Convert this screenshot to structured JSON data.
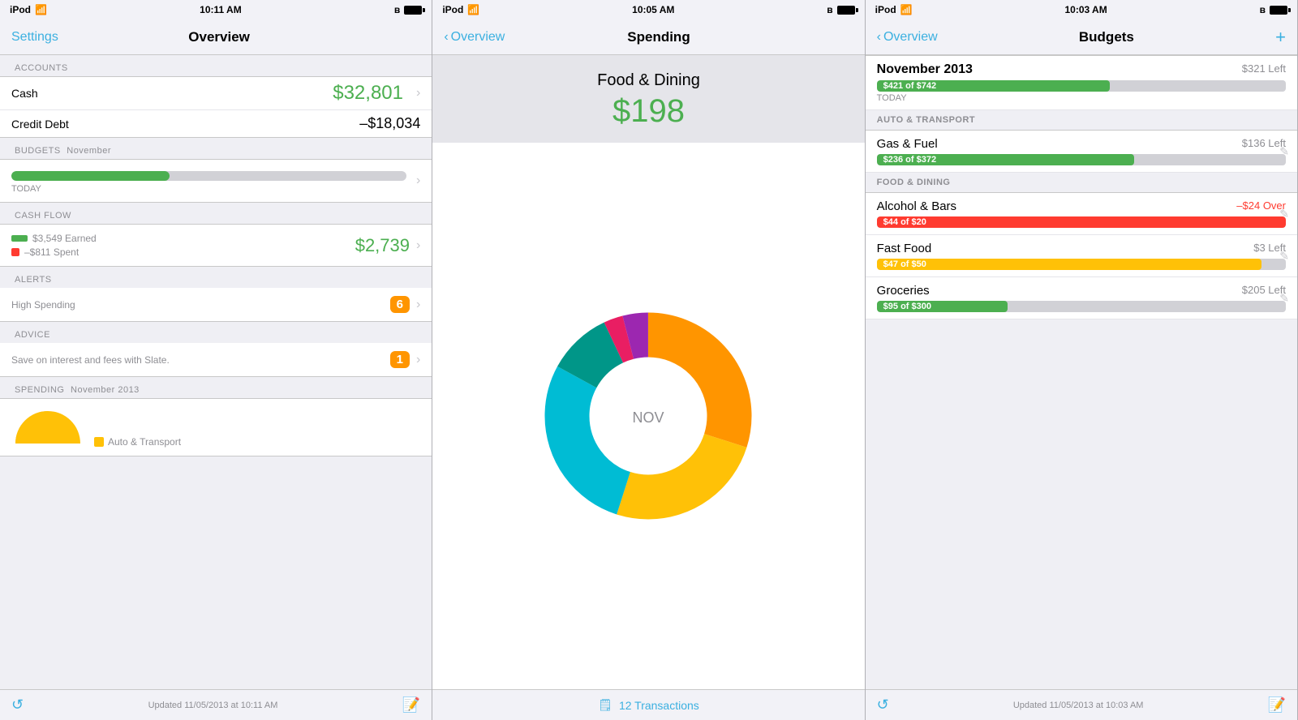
{
  "panel1": {
    "status": {
      "device": "iPod",
      "wifi": true,
      "time": "10:11 AM",
      "bluetooth": true
    },
    "nav": {
      "left": "Settings",
      "title": "Overview",
      "right": ""
    },
    "sections": {
      "accounts_label": "ACCOUNTS",
      "cash_label": "Cash",
      "cash_value": "$32,801",
      "credit_label": "Credit Debt",
      "credit_value": "–$18,034",
      "budgets_label": "BUDGETS",
      "budgets_month": "November",
      "budgets_bar_pct": 40,
      "budgets_bar_color": "#4caf50",
      "today_label": "TODAY",
      "cashflow_label": "CASH FLOW",
      "earned_label": "$3,549 Earned",
      "spent_label": "–$811 Spent",
      "cashflow_value": "$2,739",
      "alerts_label": "ALERTS",
      "alerts_sub": "High Spending",
      "alerts_badge": "6",
      "advice_label": "ADVICE",
      "advice_sub": "Save on interest and fees with Slate.",
      "advice_badge": "1",
      "spending_label": "SPENDING",
      "spending_month": "November 2013",
      "auto_transport_legend": "Auto & Transport"
    },
    "footer": {
      "updated": "Updated 11/05/2013 at 10:11 AM"
    }
  },
  "panel2": {
    "status": {
      "device": "iPod",
      "time": "10:05 AM"
    },
    "nav": {
      "left": "Overview",
      "title": "Spending",
      "right": ""
    },
    "header": {
      "title": "Food & Dining",
      "amount": "$198"
    },
    "donut": {
      "label": "NOV",
      "segments": [
        {
          "color": "#ff9500",
          "pct": 30
        },
        {
          "color": "#ffc107",
          "pct": 25
        },
        {
          "color": "#00bcd4",
          "pct": 28
        },
        {
          "color": "#009688",
          "pct": 10
        },
        {
          "color": "#e91e63",
          "pct": 3
        },
        {
          "color": "#9c27b0",
          "pct": 4
        }
      ]
    },
    "footer": {
      "transactions_count": "12 Transactions"
    }
  },
  "panel3": {
    "status": {
      "device": "iPod",
      "time": "10:03 AM"
    },
    "nav": {
      "left": "Overview",
      "title": "Budgets",
      "right": "+"
    },
    "november": {
      "name": "November 2013",
      "left": "$321 Left",
      "bar_value": "$421 of $742",
      "bar_pct": 57,
      "bar_color": "#4caf50",
      "today_label": "TODAY"
    },
    "sections": [
      {
        "header": "AUTO & TRANSPORT",
        "items": [
          {
            "name": "Gas & Fuel",
            "left": "$136 Left",
            "bar_label": "$236 of $372",
            "bar_pct": 63,
            "bar_color": "#4caf50",
            "left_status": "left"
          }
        ]
      },
      {
        "header": "FOOD & DINING",
        "items": [
          {
            "name": "Alcohol & Bars",
            "left": "–$24 Over",
            "bar_label": "$44 of $20",
            "bar_pct": 100,
            "bar_color": "#ff3b30",
            "left_status": "over"
          },
          {
            "name": "Fast Food",
            "left": "$3 Left",
            "bar_label": "$47 of $50",
            "bar_pct": 94,
            "bar_color": "#ffc107",
            "left_status": "left"
          },
          {
            "name": "Groceries",
            "left": "$205 Left",
            "bar_label": "$95 of $300",
            "bar_pct": 32,
            "bar_color": "#4caf50",
            "left_status": "left"
          }
        ]
      }
    ],
    "footer": {
      "updated": "Updated 11/05/2013 at 10:03 AM"
    }
  }
}
